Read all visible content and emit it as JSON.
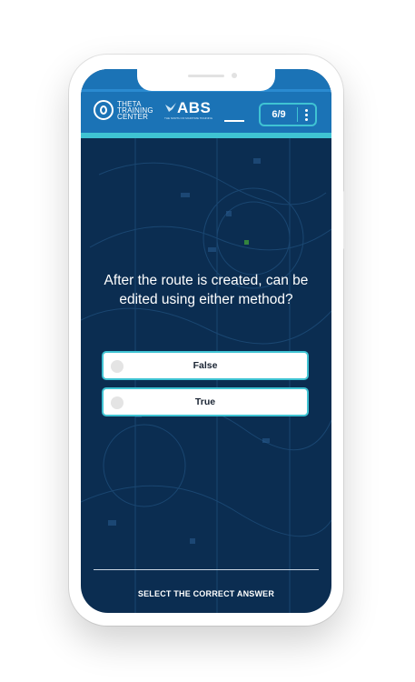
{
  "header": {
    "brand_line1": "THETA",
    "brand_line2": "TRAINING",
    "brand_line3": "CENTER",
    "partner_logo": "ABS",
    "partner_tagline": "THE NORTH OF MARITIME TRAINING",
    "progress_label": "6/9",
    "menu_icon": "vertical-dots-icon"
  },
  "question": {
    "text": "After the route is created, can be edited using either method?"
  },
  "options": [
    {
      "label": "False",
      "selected": false
    },
    {
      "label": "True",
      "selected": false
    }
  ],
  "footer": {
    "instruction": "SELECT THE CORRECT ANSWER"
  },
  "colors": {
    "header_bg": "#1b73b6",
    "accent": "#3fc3d3",
    "screen_bg": "#0b2d51",
    "option_bg": "#ffffff"
  }
}
